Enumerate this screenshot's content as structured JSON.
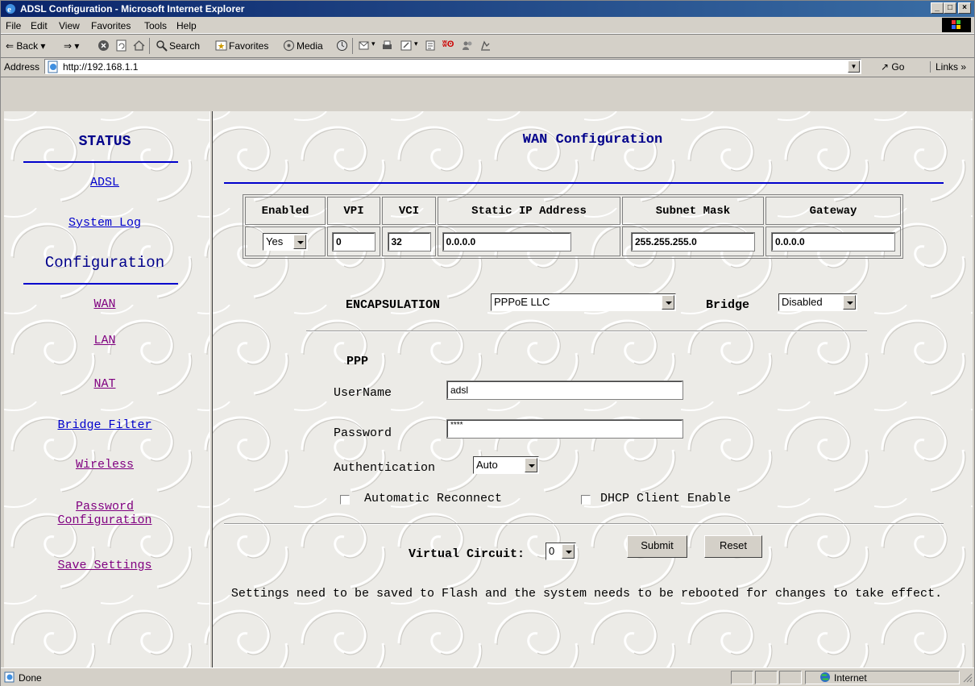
{
  "window": {
    "title": "ADSL Configuration - Microsoft Internet Explorer"
  },
  "menu": [
    "File",
    "Edit",
    "View",
    "Favorites",
    "Tools",
    "Help"
  ],
  "toolbar": {
    "back": "Back",
    "search": "Search",
    "favorites": "Favorites",
    "media": "Media"
  },
  "address": {
    "label": "Address",
    "url": "http://192.168.1.1",
    "go": "Go",
    "links": "Links »"
  },
  "nav": {
    "status_heading": "STATUS",
    "adsl": "ADSL",
    "system_log": "System Log",
    "config_heading": "Configuration",
    "wan": "WAN",
    "lan": "LAN",
    "nat": "NAT",
    "bridge_filter": "Bridge Filter",
    "wireless": "Wireless",
    "password_1": "Password",
    "password_2": "Configuration",
    "save_settings": "Save Settings"
  },
  "page": {
    "title": "WAN Configuration",
    "headers": [
      "Enabled",
      "VPI",
      "VCI",
      "Static IP Address",
      "Subnet Mask",
      "Gateway"
    ],
    "enabled": "Yes",
    "vpi": "0",
    "vci": "32",
    "static_ip": "0.0.0.0",
    "subnet": "255.255.255.0",
    "gateway": "0.0.0.0",
    "encapsulation_label": "ENCAPSULATION",
    "encapsulation": "PPPoE LLC",
    "bridge_label": "Bridge",
    "bridge": "Disabled",
    "ppp_heading": "PPP",
    "username_label": "UserName",
    "username": "adsl",
    "password_label": "Password",
    "password": "****",
    "auth_label": "Authentication",
    "auth": "Auto",
    "auto_reconnect": "Automatic Reconnect",
    "dhcp_client": "DHCP Client Enable",
    "vc_label": "Virtual Circuit:",
    "vc": "0",
    "submit": "Submit",
    "reset": "Reset",
    "note": "Settings need to be saved to Flash and the system needs to be rebooted for changes to take effect."
  },
  "status": {
    "done": "Done",
    "zone": "Internet"
  }
}
